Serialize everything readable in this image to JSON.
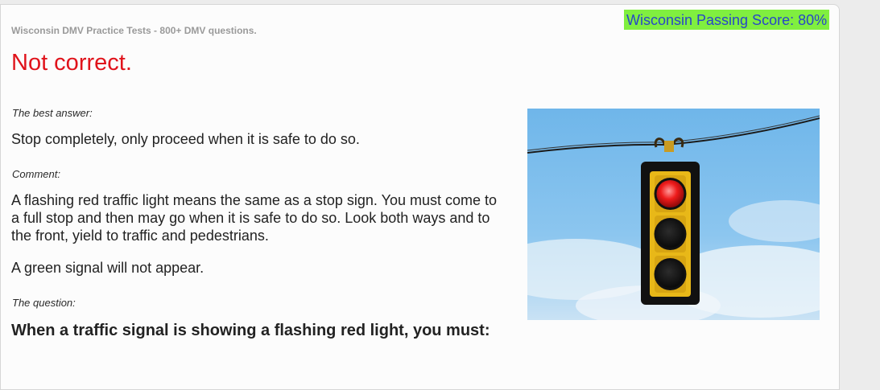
{
  "header": {
    "site_title": "Wisconsin DMV Practice Tests - 800+ DMV questions.",
    "passing_score": "Wisconsin Passing Score: 80%"
  },
  "result": {
    "heading": "Not correct.",
    "best_answer_label": "The best answer:",
    "best_answer": "Stop completely, only proceed when it is safe to do so.",
    "comment_label": "Comment:",
    "comment_p1": "A flashing red traffic light means the same as a stop sign. You must come to a full stop and then may go when it is safe to do so. Look both ways and to the front, yield to traffic and pedestrians.",
    "comment_p2": "A green signal will not appear.",
    "question_label": "The question:",
    "question": "When a traffic signal is showing a flashing red light, you must:"
  },
  "colors": {
    "heading_red": "#e0131b",
    "badge_green": "#80ef3f",
    "badge_text_blue": "#2846c8"
  },
  "image": {
    "subject": "traffic-light-red-illuminated"
  }
}
